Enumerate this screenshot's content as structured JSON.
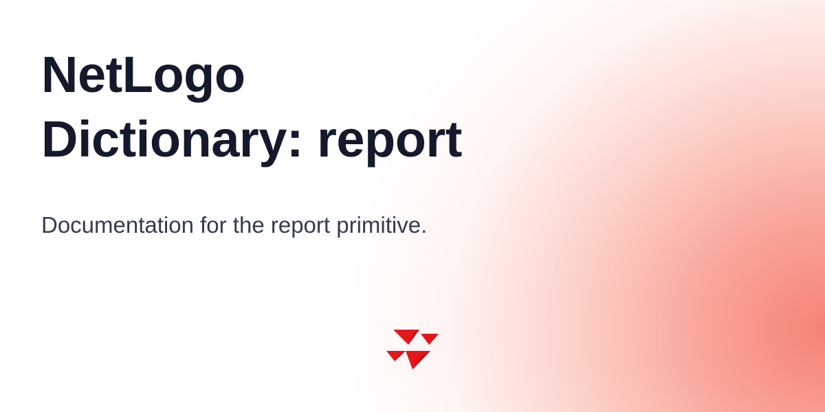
{
  "header": {
    "title_lines": [
      "NetLogo",
      "Dictionary: report"
    ],
    "subtitle": "Documentation for the report primitive."
  },
  "logo": {
    "icon": "netlogo-logo-icon",
    "colors": {
      "primary": "#e8151b",
      "dark": "#b30d12"
    }
  },
  "theme": {
    "accent": "#f58a7c",
    "title_color": "#141a2b",
    "subtitle_color": "#343c4e"
  }
}
